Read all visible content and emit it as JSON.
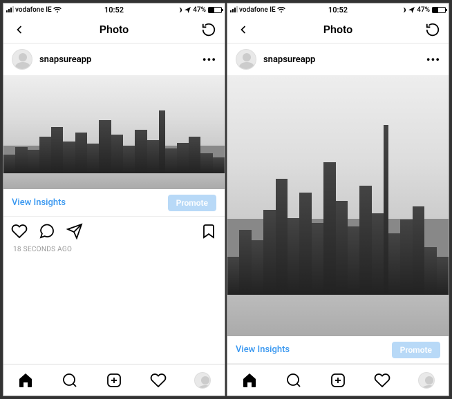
{
  "status": {
    "carrier": "vodafone IE",
    "time": "10:52",
    "battery_pct": "47%",
    "battery_fill": 47
  },
  "nav": {
    "title": "Photo"
  },
  "post": {
    "username": "snapsureapp",
    "insights_label": "View Insights",
    "promote_label": "Promote",
    "timestamp": "18 SECONDS AGO"
  }
}
